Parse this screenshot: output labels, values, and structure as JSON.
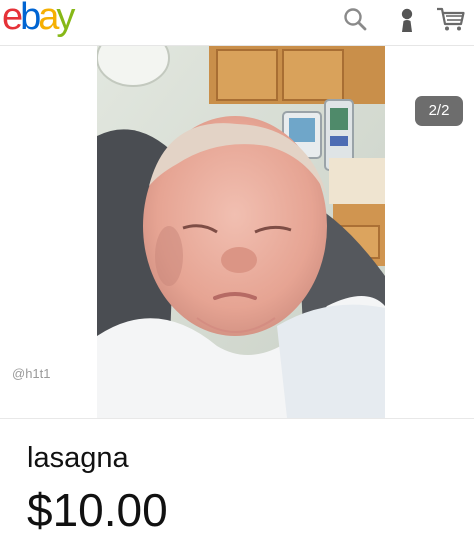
{
  "header": {
    "logo_letters": [
      "e",
      "b",
      "a",
      "y"
    ],
    "icons": [
      "search-icon",
      "user-icon",
      "cart-icon"
    ]
  },
  "gallery": {
    "counter": "2/2",
    "watermark": "@h1t1",
    "photo_subject": "newborn-photo"
  },
  "item": {
    "title": "lasagna",
    "price": "$10.00"
  },
  "colors": {
    "logo_e": "#e53238",
    "logo_b": "#0064d2",
    "logo_a": "#f5af02",
    "logo_y": "#86b817",
    "counter_bg": "#6d6d6d"
  }
}
